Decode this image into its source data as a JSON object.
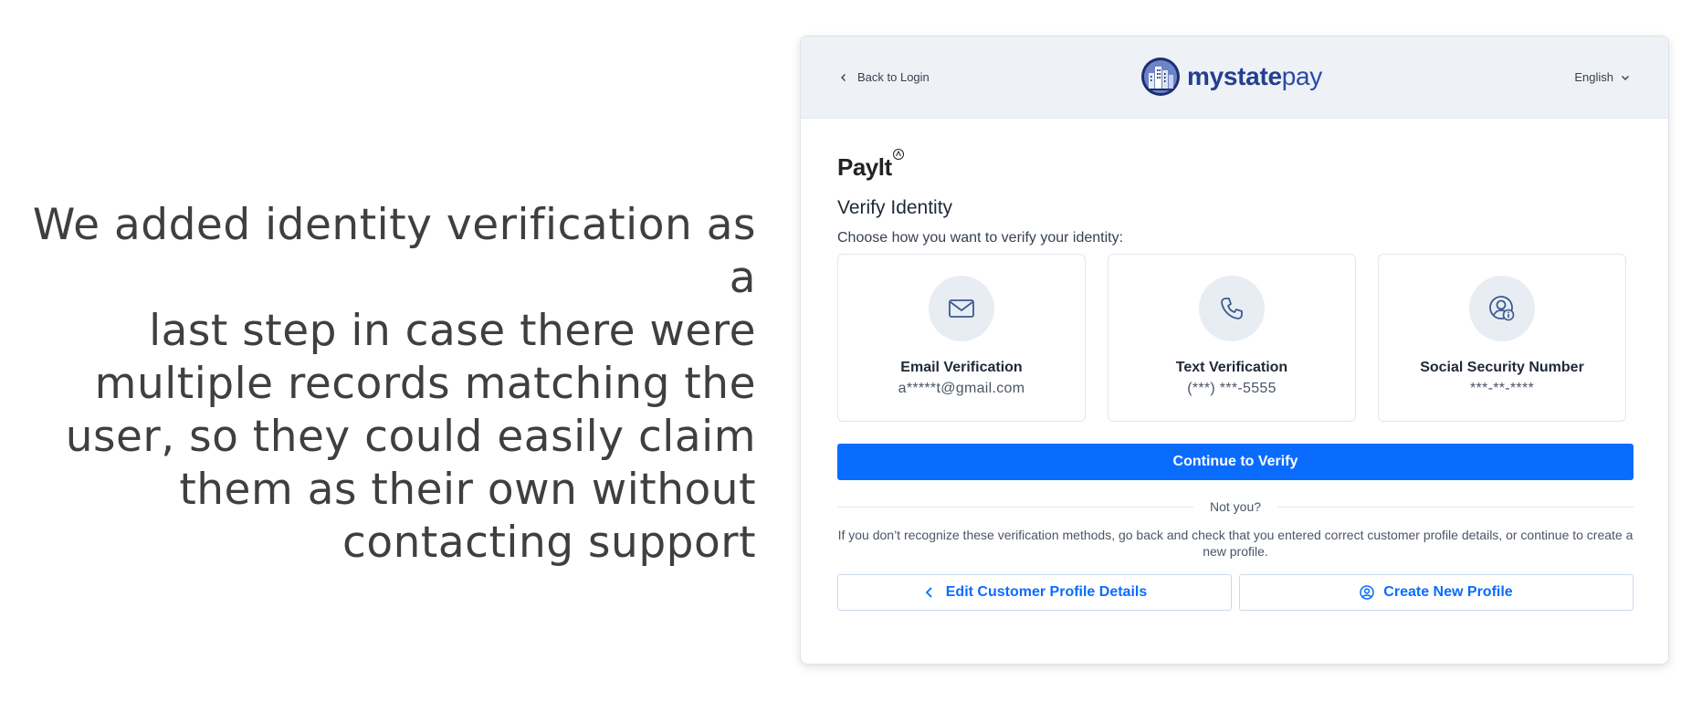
{
  "caption": {
    "lines": [
      "We added identity verification as a",
      "last step in case there were",
      "multiple records matching the",
      "user, so they could easily claim",
      "them as their own without",
      "contacting support"
    ]
  },
  "header": {
    "back_label": "Back to Login",
    "brand_bold": "mystate",
    "brand_light": "pay",
    "language": "English",
    "brand_color": "#233f8f"
  },
  "main": {
    "paylt_logo": "Paylt",
    "title": "Verify Identity",
    "subtitle": "Choose how you want to verify your identity:",
    "options": [
      {
        "icon": "envelope-icon",
        "title": "Email Verification",
        "value": "a*****t@gmail.com"
      },
      {
        "icon": "phone-icon",
        "title": "Text Verification",
        "value": "(***) ***-5555"
      },
      {
        "icon": "user-info-icon",
        "title": "Social Security Number",
        "value": "***-**-****"
      }
    ],
    "continue_label": "Continue to Verify",
    "not_you": "Not you?",
    "help_text": "If you don’t recognize these verification methods, go back and check that you entered correct customer profile details, or continue to create a new profile.",
    "edit_label": "Edit Customer Profile Details",
    "create_label": "Create New Profile",
    "accent_color": "#0a6cff"
  }
}
